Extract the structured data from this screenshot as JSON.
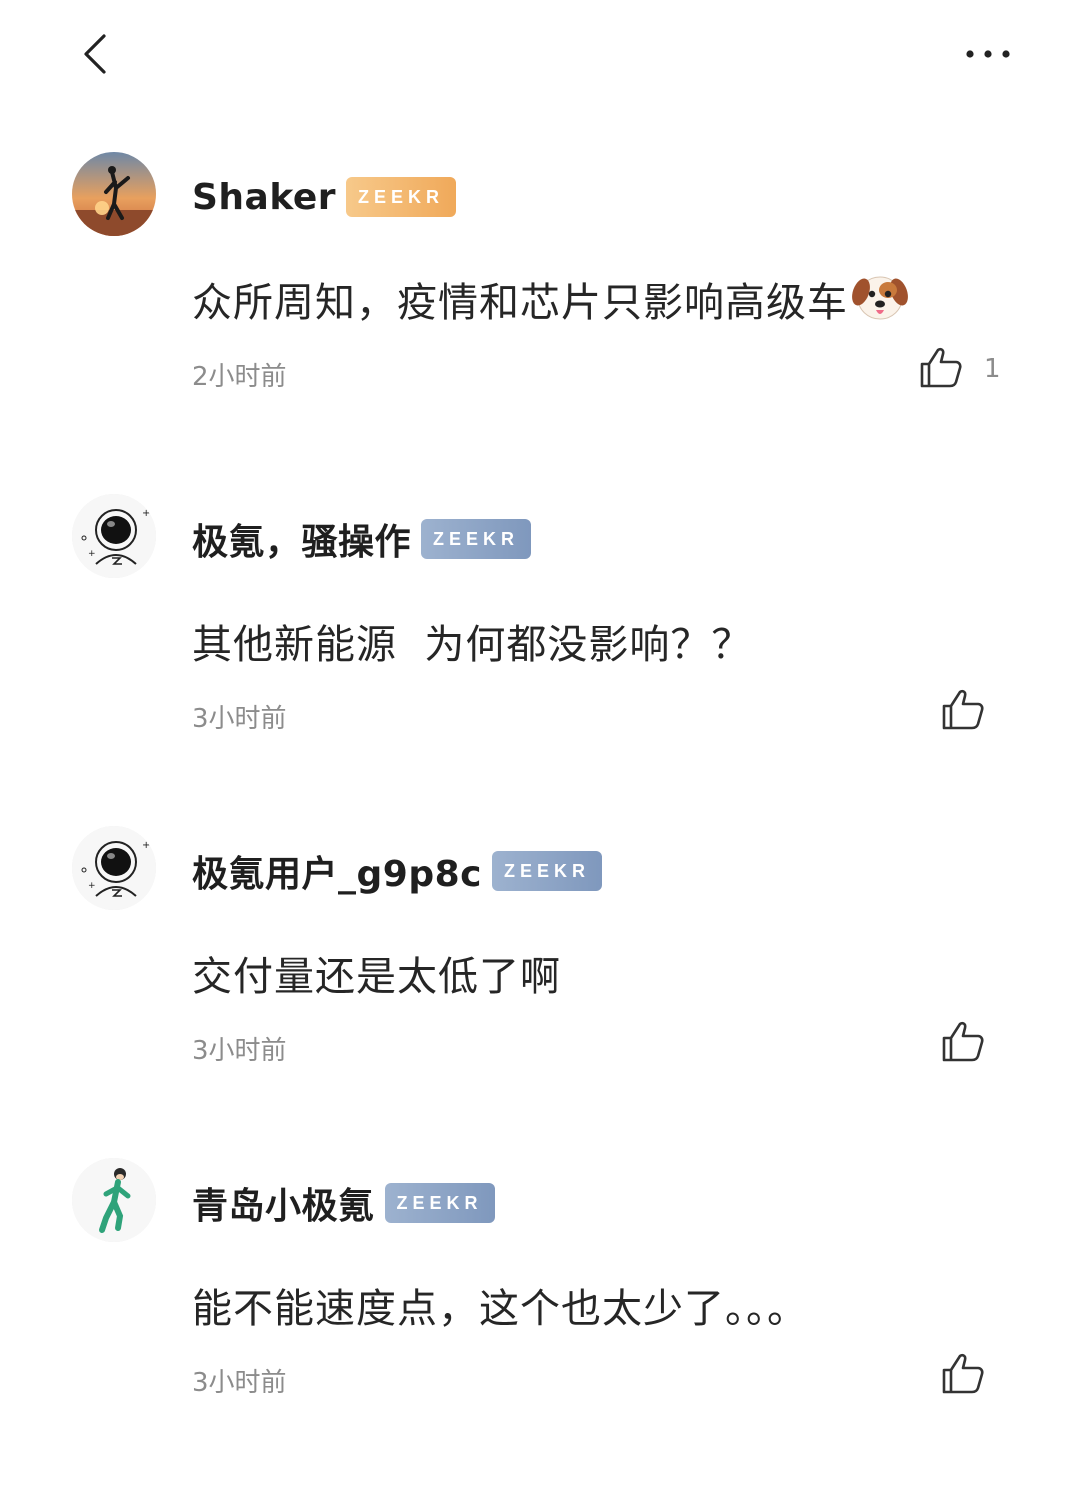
{
  "theme": {
    "badge_orange": "#f3b76a",
    "badge_blue": "#8fa7c7",
    "text_primary": "#1f1f1f",
    "text_secondary": "#8c8c8c"
  },
  "header": {
    "back_icon": "chevron-left-icon",
    "more_icon": "more-horizontal-icon"
  },
  "comments": [
    {
      "username": "Shaker",
      "badge": "ZEEKR",
      "badge_style": "orange",
      "text": "众所周知，疫情和芯片只影响高级车",
      "emoji": "dog-face-emoji",
      "time": "2小时前",
      "likes": "1"
    },
    {
      "username": "极氪，骚操作",
      "badge": "ZEEKR",
      "badge_style": "blue",
      "text": "其他新能源  为何都没影响？？",
      "time": "3小时前",
      "likes": ""
    },
    {
      "username": "极氪用户_g9p8c",
      "badge": "ZEEKR",
      "badge_style": "blue",
      "text": "交付量还是太低了啊",
      "time": "3小时前",
      "likes": ""
    },
    {
      "username": "青岛小极氪",
      "badge": "ZEEKR",
      "badge_style": "blue",
      "text": "能不能速度点，这个也太少了。。。",
      "time": "3小时前",
      "likes": ""
    }
  ]
}
